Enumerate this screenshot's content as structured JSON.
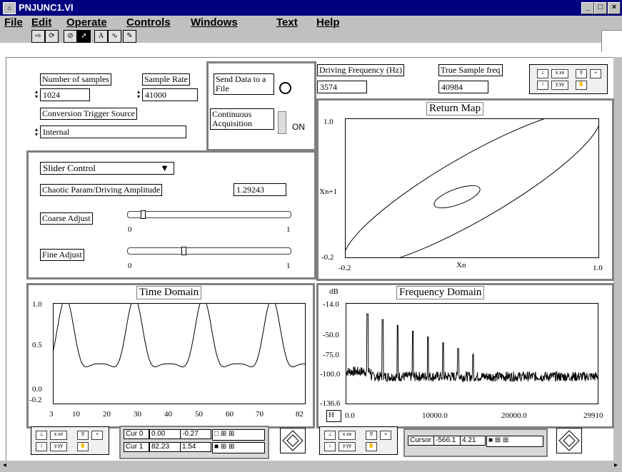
{
  "window": {
    "title": "PNJUNC1.VI",
    "icon": "labview-vi-icon",
    "buttons": [
      "_",
      "□",
      "×"
    ]
  },
  "menu": [
    "File",
    "Edit",
    "Operate",
    "Controls",
    "Windows",
    "Text",
    "Help"
  ],
  "toolbar": {
    "icons": [
      "run-icon",
      "run-continuously-icon",
      "abort-icon",
      "arrow-tool-icon",
      "text-tool-icon",
      "wire-tool-icon",
      "color-tool-icon"
    ]
  },
  "controls": {
    "num_samples_label": "Number of samples",
    "num_samples_value": "1024",
    "sample_rate_label": "Sample Rate",
    "sample_rate_value": "41000",
    "trigger_label": "Conversion Trigger Source",
    "trigger_value": "Internal",
    "send_data_label": "Send Data to a File",
    "continuous_label": "Continuous Acquisition",
    "continuous_state": "ON",
    "slider_mode": "Slider Control",
    "param_label": "Chaotic Param/Driving Amplitude",
    "param_value": "1.29243",
    "coarse_label": "Coarse Adjust",
    "fine_label": "Fine Adjust",
    "scale_min": "0",
    "scale_max": "1",
    "coarse_position": 0.08,
    "fine_position": 0.33
  },
  "driving": {
    "freq_label": "Driving Frequency (Hz)",
    "freq_value": "3574",
    "true_label": "True Sample freq",
    "true_value": "40984"
  },
  "return_map": {
    "title": "Return Map",
    "y_label": "Xn+1",
    "x_label": "Xn",
    "y_max": "1.0",
    "y_min": "-0.2",
    "x_min": "-0.2",
    "x_max": "1.0"
  },
  "time_domain": {
    "title": "Time Domain",
    "y_ticks": [
      "1.0",
      "0.5",
      "0.0",
      "-0.2"
    ],
    "x_ticks": [
      "3",
      "10",
      "20",
      "30",
      "40",
      "50",
      "60",
      "70",
      "82"
    ]
  },
  "freq_domain": {
    "title": "Frequency Domain",
    "unit": "dB",
    "y_ticks": [
      "-14.0",
      "-50.0",
      "-75.0",
      "-100.0",
      "-136.6"
    ],
    "x_ticks": [
      "0.0",
      "10000.0",
      "20000.0",
      "29910"
    ],
    "h_label": "H"
  },
  "time_cursors": [
    {
      "name": "Cur 0",
      "x": "0.00",
      "y": "-0.27"
    },
    {
      "name": "Cur 1",
      "x": "82.23",
      "y": "1.54"
    }
  ],
  "freq_cursor": {
    "name": "Cursor",
    "x": "-566.1",
    "y": "4.21"
  },
  "palette": {
    "x_fmt": "x.xx",
    "y_fmt": "y.yy"
  }
}
